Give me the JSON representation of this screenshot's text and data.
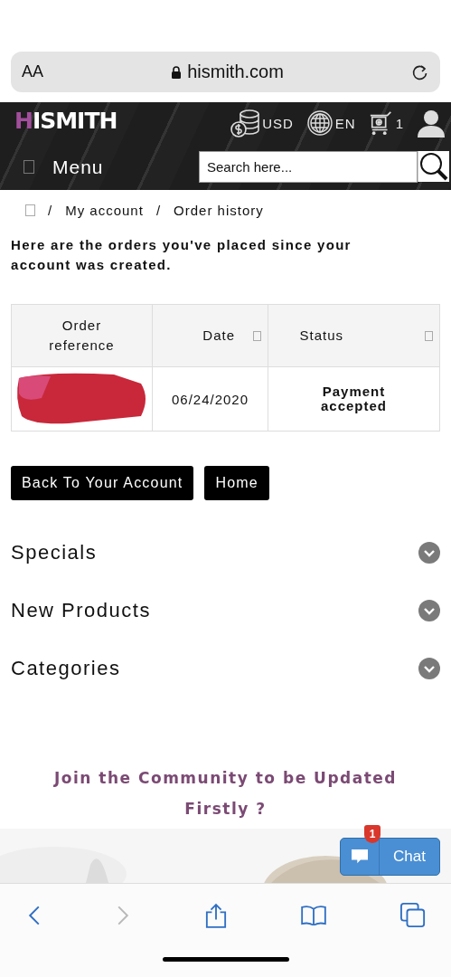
{
  "browser": {
    "text_size": "AA",
    "url": "hismith.com"
  },
  "header": {
    "logo": {
      "accent": "H",
      "rest": "ISMITH"
    },
    "currency": "USD",
    "language": "EN",
    "cart_count": "1",
    "menu": "Menu",
    "search": {
      "placeholder": "Search here..."
    }
  },
  "breadcrumb": [
    {
      "separator": "/",
      "label": "My account"
    },
    {
      "separator": "/",
      "label": "Order history"
    }
  ],
  "intro": "Here are the orders you've placed since your account was created.",
  "table": {
    "columns": [
      {
        "label": "Order reference",
        "sortable": false
      },
      {
        "label": "Date",
        "sortable": true
      },
      {
        "label": "Status",
        "sortable": true
      }
    ],
    "rows": [
      {
        "date": "06/24/2020",
        "status": "Payment accepted"
      }
    ]
  },
  "buttons": [
    "Back To Your Account",
    "Home"
  ],
  "sections": [
    {
      "label": "Specials",
      "expanded": false
    },
    {
      "label": "New Products",
      "expanded": false
    },
    {
      "label": "Categories",
      "expanded": false
    }
  ],
  "newsletter": {
    "title": "Join the Community to be Updated Firstly ?"
  },
  "chat": {
    "label": "Chat",
    "badge": "1"
  }
}
